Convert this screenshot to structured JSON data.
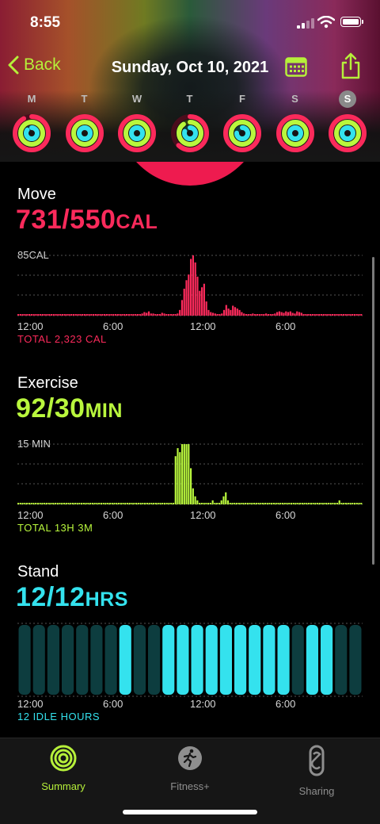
{
  "status": {
    "time": "8:55"
  },
  "nav": {
    "back_label": "Back",
    "title": "Sunday, Oct 10, 2021"
  },
  "week": [
    {
      "letter": "M",
      "move": 0.92,
      "exercise": 1.0,
      "stand": 0.85,
      "selected": false
    },
    {
      "letter": "T",
      "move": 1.0,
      "exercise": 1.0,
      "stand": 1.0,
      "selected": false
    },
    {
      "letter": "W",
      "move": 1.0,
      "exercise": 1.0,
      "stand": 1.0,
      "selected": false
    },
    {
      "letter": "T",
      "move": 0.62,
      "exercise": 0.9,
      "stand": 0.8,
      "selected": false
    },
    {
      "letter": "F",
      "move": 1.0,
      "exercise": 1.0,
      "stand": 0.75,
      "selected": false
    },
    {
      "letter": "S",
      "move": 1.0,
      "exercise": 1.0,
      "stand": 1.0,
      "selected": false
    },
    {
      "letter": "S",
      "move": 1.0,
      "exercise": 1.0,
      "stand": 1.0,
      "selected": true
    }
  ],
  "move": {
    "title": "Move",
    "value": "731/550",
    "unit": "CAL",
    "max_label": "85CAL",
    "total": "TOTAL 2,323 CAL",
    "color": "#fb2a5b",
    "x_labels": [
      "12:00",
      "6:00",
      "12:00",
      "6:00"
    ],
    "values": [
      2,
      2,
      2,
      2,
      2,
      2,
      2,
      2,
      2,
      2,
      2,
      2,
      2,
      2,
      2,
      2,
      2,
      2,
      2,
      2,
      2,
      2,
      2,
      2,
      2,
      2,
      2,
      2,
      2,
      2,
      2,
      2,
      2,
      2,
      2,
      2,
      2,
      2,
      2,
      2,
      2,
      2,
      2,
      2,
      2,
      2,
      2,
      2,
      2,
      2,
      2,
      2,
      2,
      2,
      2,
      2,
      3,
      5,
      4,
      6,
      3,
      3,
      2,
      2,
      2,
      4,
      3,
      2,
      2,
      2,
      2,
      2,
      3,
      8,
      22,
      38,
      50,
      58,
      80,
      85,
      75,
      55,
      35,
      40,
      45,
      20,
      8,
      5,
      4,
      3,
      2,
      2,
      3,
      8,
      15,
      10,
      8,
      14,
      12,
      10,
      8,
      5,
      3,
      2,
      2,
      2,
      3,
      2,
      2,
      2,
      2,
      2,
      3,
      2,
      2,
      2,
      3,
      5,
      6,
      5,
      4,
      6,
      5,
      6,
      4,
      3,
      6,
      5,
      4,
      2,
      2,
      2,
      2,
      2,
      2,
      2,
      2,
      2,
      2,
      2,
      2,
      2,
      2,
      2,
      2,
      2,
      2,
      2,
      2,
      2,
      2,
      2,
      2,
      2,
      2,
      2
    ]
  },
  "exercise": {
    "title": "Exercise",
    "value": "92/30",
    "unit": "MIN",
    "max_label": "15 MIN",
    "total": "TOTAL 13H 3M",
    "color": "#b9f73d",
    "x_labels": [
      "12:00",
      "6:00",
      "12:00",
      "6:00"
    ],
    "values": [
      0,
      0,
      0,
      0,
      0,
      0,
      0,
      0,
      0,
      0,
      0,
      0,
      0,
      0,
      0,
      0,
      0,
      0,
      0,
      0,
      0,
      0,
      0,
      0,
      0,
      0,
      0,
      0,
      0,
      0,
      0,
      0,
      0,
      0,
      0,
      0,
      0,
      0,
      0,
      0,
      0,
      0,
      0,
      0,
      0,
      0,
      0,
      0,
      0,
      0,
      0,
      0,
      0,
      0,
      0,
      0,
      0,
      0,
      0,
      0,
      0,
      0,
      0,
      0,
      0,
      0,
      0,
      0,
      0,
      0,
      0,
      0,
      12,
      14,
      13,
      15,
      15,
      15,
      15,
      9,
      4,
      2,
      1,
      0,
      0,
      0,
      0,
      0,
      0,
      1,
      0,
      0,
      0,
      1,
      2,
      3,
      1,
      0,
      0,
      0,
      0,
      0,
      0,
      0,
      0,
      0,
      0,
      0,
      0,
      0,
      0,
      0,
      0,
      0,
      0,
      0,
      0,
      0,
      0,
      0,
      0,
      0,
      0,
      0,
      0,
      0,
      0,
      0,
      0,
      0,
      0,
      0,
      0,
      0,
      0,
      0,
      0,
      0,
      0,
      0,
      0,
      0,
      0,
      0,
      0,
      0,
      0,
      1,
      0,
      0,
      0,
      0,
      0,
      0,
      0,
      0,
      0,
      0
    ]
  },
  "stand": {
    "title": "Stand",
    "value": "12/12",
    "unit": "HRS",
    "idle": "12 IDLE HOURS",
    "color": "#34e2ee",
    "idle_color": "#0d3d3f",
    "x_labels": [
      "12:00",
      "6:00",
      "12:00",
      "6:00"
    ],
    "hours": [
      0,
      0,
      0,
      0,
      0,
      0,
      0,
      1,
      0,
      0,
      1,
      1,
      1,
      1,
      1,
      1,
      1,
      1,
      1,
      0,
      1,
      1,
      0,
      0
    ]
  },
  "tabs": [
    {
      "label": "Summary",
      "icon": "activity-rings-icon",
      "active": true
    },
    {
      "label": "Fitness+",
      "icon": "running-figure-icon",
      "active": false
    },
    {
      "label": "Sharing",
      "icon": "sharing-rings-icon",
      "active": false
    }
  ]
}
